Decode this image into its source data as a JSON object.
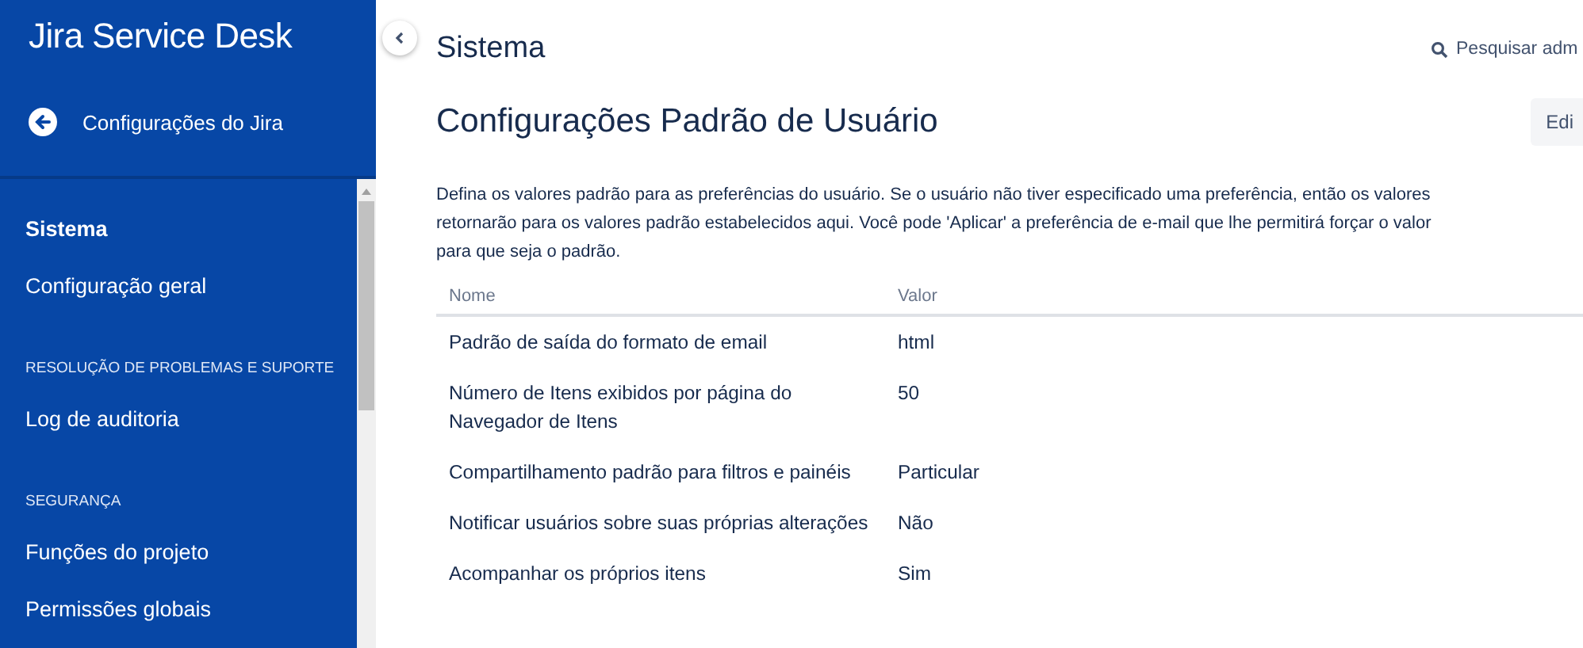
{
  "sidebar": {
    "product_title": "Jira Service Desk",
    "back_link": "Configurações do Jira",
    "sections": [
      {
        "items": [
          {
            "label": "Sistema",
            "selected": true
          },
          {
            "label": "Configuração geral",
            "selected": false
          }
        ]
      },
      {
        "header": "RESOLUÇÃO DE PROBLEMAS E SUPORTE",
        "items": [
          {
            "label": "Log de auditoria",
            "selected": false
          }
        ]
      },
      {
        "header": "SEGURANÇA",
        "items": [
          {
            "label": "Funções do projeto",
            "selected": false
          },
          {
            "label": "Permissões globais",
            "selected": false
          }
        ]
      }
    ]
  },
  "page": {
    "title": "Sistema",
    "search": {
      "placeholder": "Pesquisar adm"
    },
    "heading": "Configurações Padrão de Usuário",
    "edit_button": "Edi",
    "description_lines": [
      "Defina os valores padrão para as preferências do usuário. Se o usuário não tiver especificado uma preferência, então os valores",
      "retornarão para os valores padrão estabelecidos aqui. Você pode 'Aplicar' a preferência de e-mail que lhe permitirá forçar o valor",
      "para que seja o padrão."
    ],
    "table": {
      "columns": [
        "Nome",
        "Valor"
      ],
      "rows": [
        [
          "Padrão de saída do formato de email",
          "html"
        ],
        [
          "Número de Itens exibidos por página do Navegador de Itens",
          "50"
        ],
        [
          "Compartilhamento padrão para filtros e painéis",
          "Particular"
        ],
        [
          "Notificar usuários sobre suas próprias alterações",
          "Não"
        ],
        [
          "Acompanhar os próprios itens",
          "Sim"
        ]
      ]
    }
  }
}
